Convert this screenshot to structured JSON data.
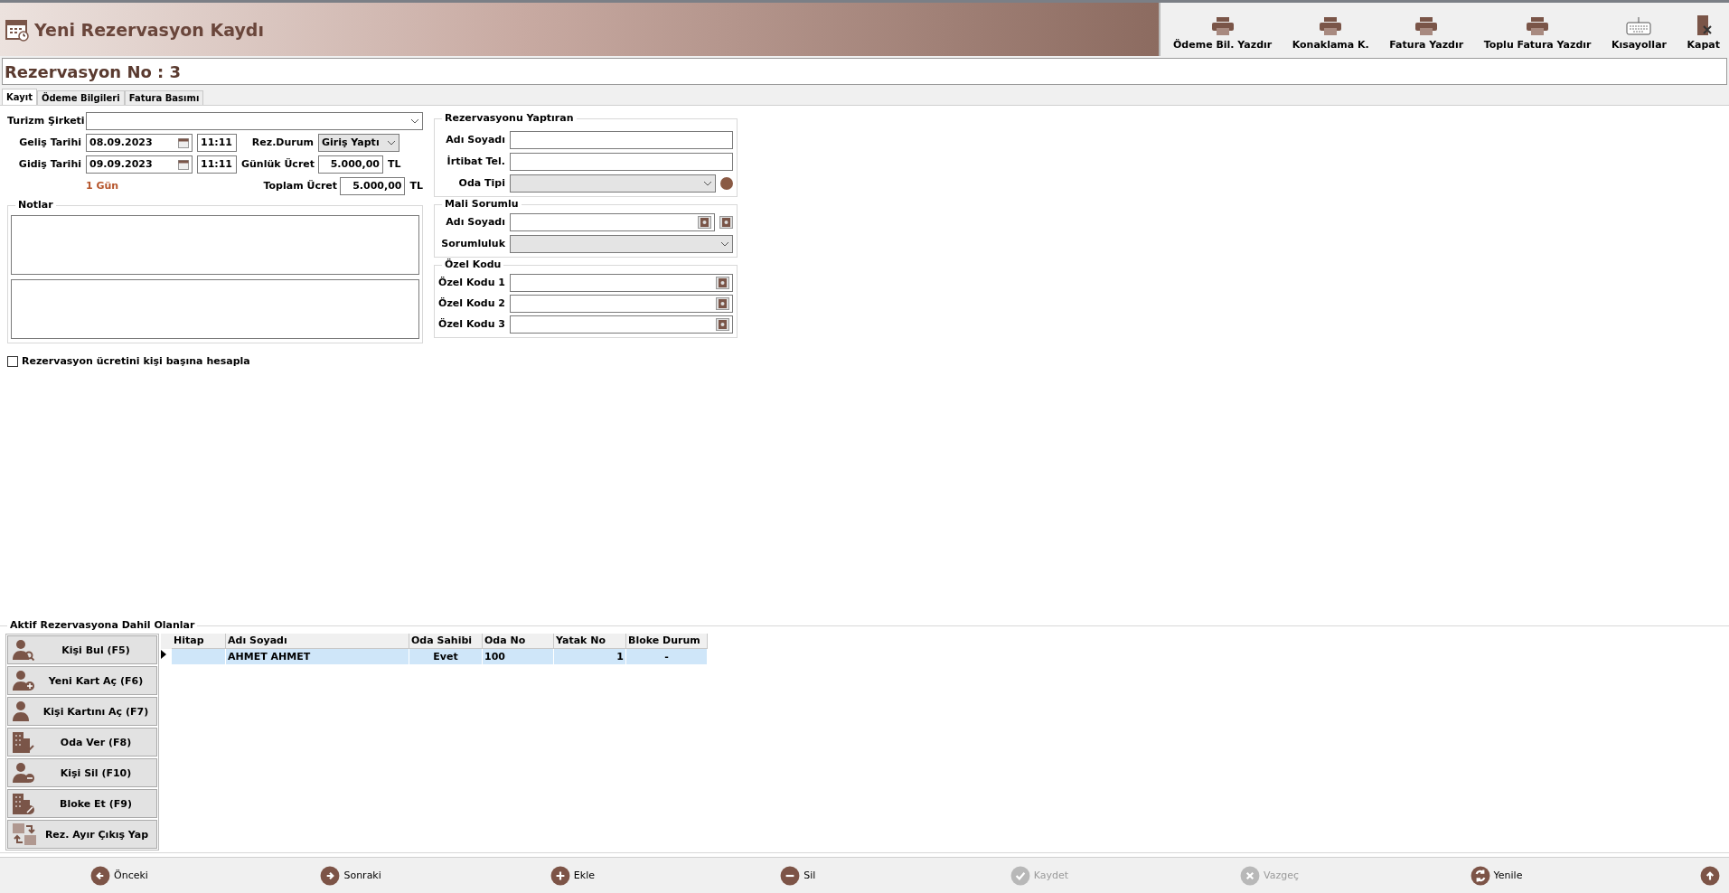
{
  "window": {
    "title": "Yeni Rezervasyon Kaydı"
  },
  "toolbar": [
    {
      "label": "Ödeme Bil. Yazdır",
      "kind": "printer"
    },
    {
      "label": "Konaklama K.",
      "kind": "printer"
    },
    {
      "label": "Fatura Yazdır",
      "kind": "printer"
    },
    {
      "label": "Toplu Fatura Yazdır",
      "kind": "printer"
    },
    {
      "label": "Kısayollar",
      "kind": "keyboard"
    },
    {
      "label": "Kapat",
      "kind": "exit"
    }
  ],
  "reservation_no": "Rezervasyon No : 3",
  "tabs": [
    {
      "label": "Kayıt",
      "selected": true
    },
    {
      "label": "Ödeme Bilgileri",
      "selected": false
    },
    {
      "label": "Fatura Basımı",
      "selected": false
    }
  ],
  "form": {
    "tourism_company": {
      "label": "Turizm Şirketi"
    },
    "arrival": {
      "label": "Geliş Tarihi",
      "date": "08.09.2023",
      "time": "11:11"
    },
    "departure": {
      "label": "Gidiş Tarihi",
      "date": "09.09.2023",
      "time": "11:11"
    },
    "duration": "1 Gün",
    "status": {
      "label": "Rez.Durum",
      "value": "Giriş Yaptı"
    },
    "daily_fee": {
      "label": "Günlük Ücret",
      "value": "5.000,00",
      "currency": "TL"
    },
    "total_fee": {
      "label": "Toplam Ücret",
      "value": "5.000,00",
      "currency": "TL"
    },
    "notes": {
      "title": "Notlar"
    },
    "per_person": {
      "label": "Rezervasyon ücretini kişi başına hesapla",
      "checked": false
    }
  },
  "booker": {
    "title": "Rezervasyonu Yaptıran",
    "name_label": "Adı Soyadı",
    "phone_label": "İrtibat Tel.",
    "room_type_label": "Oda Tipi"
  },
  "financial": {
    "title": "Mali Sorumlu",
    "name_label": "Adı Soyadı",
    "responsibility_label": "Sorumluluk"
  },
  "special_codes": {
    "title": "Özel Kodu",
    "labels": [
      "Özel Kodu 1",
      "Özel Kodu 2",
      "Özel Kodu 3"
    ]
  },
  "guests": {
    "title": "Aktif Rezervasyona Dahil Olanlar",
    "actions": [
      {
        "label": "Kişi Bul (F5)",
        "kind": "person-search"
      },
      {
        "label": "Yeni Kart Aç (F6)",
        "kind": "person-add"
      },
      {
        "label": "Kişi Kartını Aç (F7)",
        "kind": "person"
      },
      {
        "label": "Oda Ver (F8)",
        "kind": "building-check"
      },
      {
        "label": "Kişi Sil (F10)",
        "kind": "person-remove"
      },
      {
        "label": "Bloke Et (F9)",
        "kind": "building-block"
      },
      {
        "label": "Rez. Ayır Çıkış Yap",
        "kind": "swap"
      }
    ],
    "table": {
      "columns": [
        "Hitap",
        "Adı Soyadı",
        "Oda Sahibi",
        "Oda No",
        "Yatak No",
        "Bloke Durum"
      ],
      "rows": [
        {
          "selected": true,
          "cells": [
            "",
            "AHMET AHMET",
            "Evet",
            "100",
            "1",
            "-"
          ]
        }
      ]
    }
  },
  "footer": [
    {
      "label": "Önceki",
      "kind": "left",
      "disabled": false
    },
    {
      "label": "Sonraki",
      "kind": "right",
      "disabled": false
    },
    {
      "label": "Ekle",
      "kind": "plus",
      "disabled": false
    },
    {
      "label": "Sil",
      "kind": "minus",
      "disabled": false
    },
    {
      "label": "Kaydet",
      "kind": "check",
      "disabled": true
    },
    {
      "label": "Vazgeç",
      "kind": "cross",
      "disabled": true
    },
    {
      "label": "Yenile",
      "kind": "refresh",
      "disabled": false
    },
    {
      "kind": "up",
      "disabled": false
    }
  ]
}
